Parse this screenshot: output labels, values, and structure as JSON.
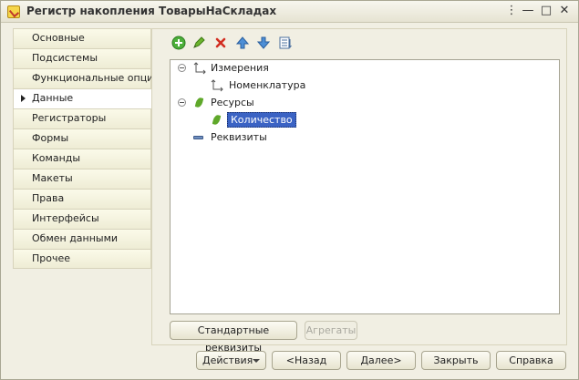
{
  "window": {
    "title": "Регистр накопления ТоварыНаСкладах"
  },
  "titlebar_buttons": {
    "more": "⋮",
    "minimize": "—",
    "maximize": "□",
    "close": "✕"
  },
  "tabs": [
    {
      "label": "Основные"
    },
    {
      "label": "Подсистемы"
    },
    {
      "label": "Функциональные опции"
    },
    {
      "label": "Данные",
      "active": true
    },
    {
      "label": "Регистраторы"
    },
    {
      "label": "Формы"
    },
    {
      "label": "Команды"
    },
    {
      "label": "Макеты"
    },
    {
      "label": "Права"
    },
    {
      "label": "Интерфейсы"
    },
    {
      "label": "Обмен данными"
    },
    {
      "label": "Прочее"
    }
  ],
  "toolbar": {
    "icons": [
      "add-icon",
      "edit-icon",
      "delete-icon",
      "move-up-icon",
      "move-down-icon",
      "sort-list-icon"
    ]
  },
  "tree": {
    "dimensions": {
      "label": "Измерения",
      "children": [
        "Номенклатура"
      ]
    },
    "resources": {
      "label": "Ресурсы",
      "children": [
        "Количество"
      ]
    },
    "attributes": {
      "label": "Реквизиты"
    }
  },
  "panel_buttons": {
    "standard_attributes": "Стандартные реквизиты",
    "aggregates": "Агрегаты"
  },
  "footer": {
    "actions": "Действия",
    "back": "<Назад",
    "next": "Далее>",
    "close": "Закрыть",
    "help": "Справка"
  },
  "colors": {
    "selection": "#3b63c4",
    "window_bg": "#f1efe3"
  }
}
